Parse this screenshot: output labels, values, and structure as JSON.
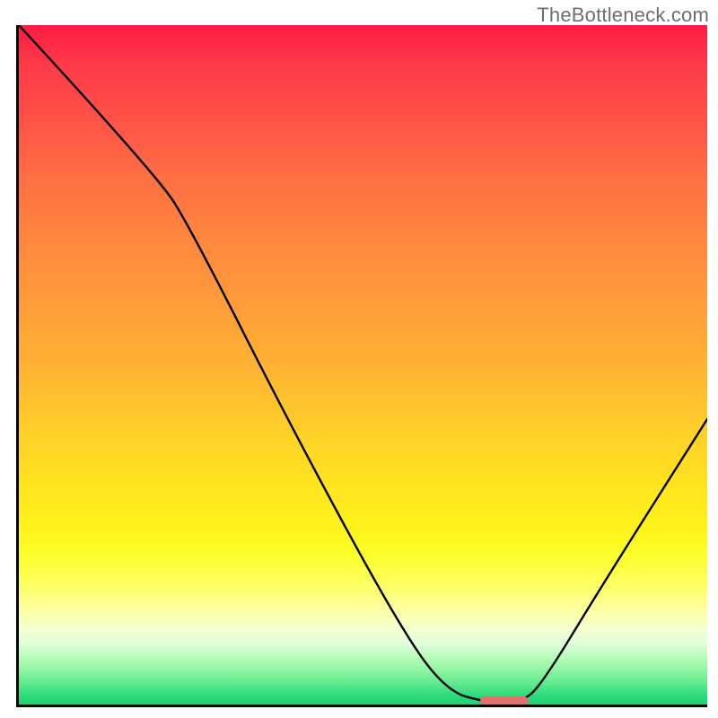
{
  "watermark": "TheBottleneck.com",
  "chart_data": {
    "type": "line",
    "title": "",
    "xlabel": "",
    "ylabel": "",
    "xlim": [
      0,
      100
    ],
    "ylim": [
      0,
      100
    ],
    "grid": false,
    "curve": [
      {
        "x": 0,
        "y": 100
      },
      {
        "x": 20,
        "y": 78
      },
      {
        "x": 25,
        "y": 70
      },
      {
        "x": 40,
        "y": 40
      },
      {
        "x": 55,
        "y": 12
      },
      {
        "x": 62,
        "y": 2
      },
      {
        "x": 68,
        "y": 0.3
      },
      {
        "x": 73,
        "y": 0.3
      },
      {
        "x": 76,
        "y": 3
      },
      {
        "x": 85,
        "y": 18
      },
      {
        "x": 100,
        "y": 42
      }
    ],
    "optimal_range_x": [
      67,
      74
    ],
    "background": {
      "type": "vertical-gradient",
      "stops": [
        {
          "pos": 0,
          "color": "#ff1a44"
        },
        {
          "pos": 0.5,
          "color": "#ffb233"
        },
        {
          "pos": 0.78,
          "color": "#fcff2a"
        },
        {
          "pos": 1.0,
          "color": "#1cd673"
        }
      ]
    }
  },
  "colors": {
    "axis": "#000000",
    "curve": "#000000",
    "marker": "#e26f6b",
    "watermark": "#6e6e6e"
  }
}
